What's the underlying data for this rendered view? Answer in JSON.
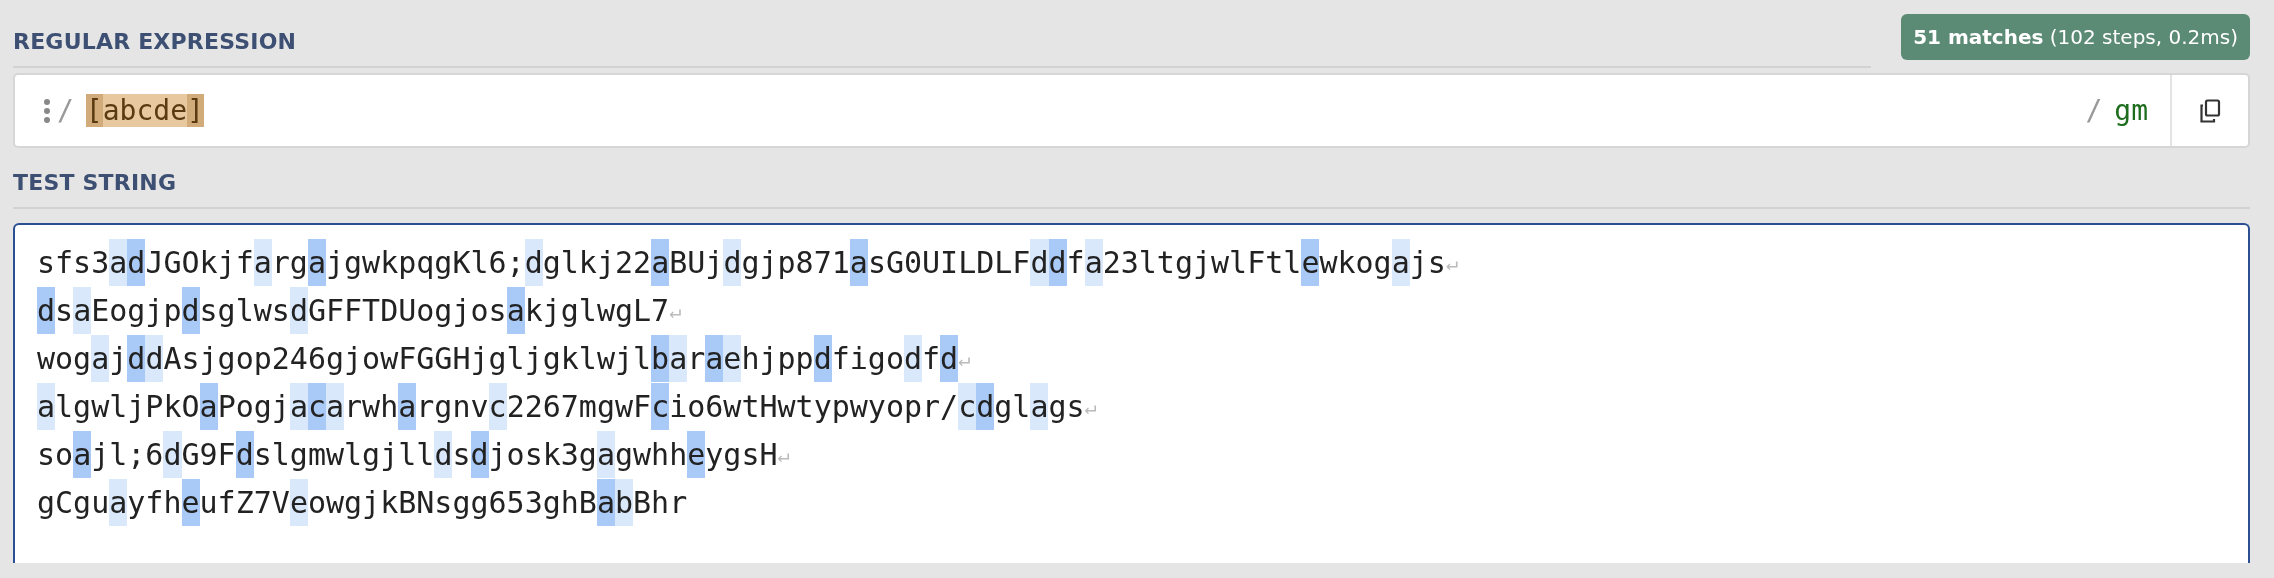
{
  "regex_section": {
    "title": "REGULAR EXPRESSION",
    "match_info": "**51 matches** (102 steps, 0.2ms)",
    "delimiter_open": "/",
    "pattern": [
      {
        "text": "[",
        "kind": "bracket"
      },
      {
        "text": "abcde",
        "kind": "set"
      },
      {
        "text": "]",
        "kind": "bracket"
      }
    ],
    "delimiter_close": "/",
    "flags": "gm"
  },
  "test_section": {
    "title": "TEST STRING",
    "lines": [
      {
        "end_mark": "↵",
        "segments": [
          {
            "text": "sfs3",
            "kind": "plain"
          },
          {
            "text": "a",
            "kind": "match"
          },
          {
            "text": "d",
            "kind": "match-alt"
          },
          {
            "text": "JGOkjf",
            "kind": "plain"
          },
          {
            "text": "a",
            "kind": "match"
          },
          {
            "text": "rg",
            "kind": "plain"
          },
          {
            "text": "a",
            "kind": "match-alt"
          },
          {
            "text": "jgwkpqgKl6;",
            "kind": "plain"
          },
          {
            "text": "d",
            "kind": "match"
          },
          {
            "text": "glkj22",
            "kind": "plain"
          },
          {
            "text": "a",
            "kind": "match-alt"
          },
          {
            "text": "BUj",
            "kind": "plain"
          },
          {
            "text": "d",
            "kind": "match"
          },
          {
            "text": "gjp871",
            "kind": "plain"
          },
          {
            "text": "a",
            "kind": "match-alt"
          },
          {
            "text": "sG0UILDLF",
            "kind": "plain"
          },
          {
            "text": "d",
            "kind": "match"
          },
          {
            "text": "d",
            "kind": "match-alt"
          },
          {
            "text": "f",
            "kind": "plain"
          },
          {
            "text": "a",
            "kind": "match"
          },
          {
            "text": "23ltgjwlFtl",
            "kind": "plain"
          },
          {
            "text": "e",
            "kind": "match-alt"
          },
          {
            "text": "wkog",
            "kind": "plain"
          },
          {
            "text": "a",
            "kind": "match"
          },
          {
            "text": "js",
            "kind": "plain"
          }
        ]
      },
      {
        "end_mark": "↵",
        "segments": [
          {
            "text": "d",
            "kind": "match-alt"
          },
          {
            "text": "s",
            "kind": "plain"
          },
          {
            "text": "a",
            "kind": "match"
          },
          {
            "text": "Eogjp",
            "kind": "plain"
          },
          {
            "text": "d",
            "kind": "match-alt"
          },
          {
            "text": "sglws",
            "kind": "plain"
          },
          {
            "text": "d",
            "kind": "match"
          },
          {
            "text": "GFFTDUogjos",
            "kind": "plain"
          },
          {
            "text": "a",
            "kind": "match-alt"
          },
          {
            "text": "kjglwgL7",
            "kind": "plain"
          }
        ]
      },
      {
        "end_mark": "↵",
        "segments": [
          {
            "text": "wog",
            "kind": "plain"
          },
          {
            "text": "a",
            "kind": "match"
          },
          {
            "text": "j",
            "kind": "plain"
          },
          {
            "text": "d",
            "kind": "match-alt"
          },
          {
            "text": "d",
            "kind": "match"
          },
          {
            "text": "Asjgop246gjowFGGHjgljgklwjl",
            "kind": "plain"
          },
          {
            "text": "b",
            "kind": "match-alt"
          },
          {
            "text": "a",
            "kind": "match"
          },
          {
            "text": "r",
            "kind": "plain"
          },
          {
            "text": "a",
            "kind": "match-alt"
          },
          {
            "text": "e",
            "kind": "match"
          },
          {
            "text": "hjpp",
            "kind": "plain"
          },
          {
            "text": "d",
            "kind": "match-alt"
          },
          {
            "text": "figo",
            "kind": "plain"
          },
          {
            "text": "d",
            "kind": "match"
          },
          {
            "text": "f",
            "kind": "plain"
          },
          {
            "text": "d",
            "kind": "match-alt"
          }
        ]
      },
      {
        "end_mark": "↵",
        "segments": [
          {
            "text": "a",
            "kind": "match"
          },
          {
            "text": "lgwljPkO",
            "kind": "plain"
          },
          {
            "text": "a",
            "kind": "match-alt"
          },
          {
            "text": "Pogj",
            "kind": "plain"
          },
          {
            "text": "a",
            "kind": "match"
          },
          {
            "text": "c",
            "kind": "match-alt"
          },
          {
            "text": "a",
            "kind": "match"
          },
          {
            "text": "rwh",
            "kind": "plain"
          },
          {
            "text": "a",
            "kind": "match-alt"
          },
          {
            "text": "rgnv",
            "kind": "plain"
          },
          {
            "text": "c",
            "kind": "match"
          },
          {
            "text": "2267mgwF",
            "kind": "plain"
          },
          {
            "text": "c",
            "kind": "match-alt"
          },
          {
            "text": "io6wtHwtypwyopr/",
            "kind": "plain"
          },
          {
            "text": "c",
            "kind": "match"
          },
          {
            "text": "d",
            "kind": "match-alt"
          },
          {
            "text": "gl",
            "kind": "plain"
          },
          {
            "text": "a",
            "kind": "match"
          },
          {
            "text": "gs",
            "kind": "plain"
          }
        ]
      },
      {
        "end_mark": "↵",
        "segments": [
          {
            "text": "so",
            "kind": "plain"
          },
          {
            "text": "a",
            "kind": "match-alt"
          },
          {
            "text": "jl;6",
            "kind": "plain"
          },
          {
            "text": "d",
            "kind": "match"
          },
          {
            "text": "G9F",
            "kind": "plain"
          },
          {
            "text": "d",
            "kind": "match-alt"
          },
          {
            "text": "slgmwlgjll",
            "kind": "plain"
          },
          {
            "text": "d",
            "kind": "match"
          },
          {
            "text": "s",
            "kind": "plain"
          },
          {
            "text": "d",
            "kind": "match-alt"
          },
          {
            "text": "josk3g",
            "kind": "plain"
          },
          {
            "text": "a",
            "kind": "match"
          },
          {
            "text": "gwhh",
            "kind": "plain"
          },
          {
            "text": "e",
            "kind": "match-alt"
          },
          {
            "text": "ygsH",
            "kind": "plain"
          }
        ]
      },
      {
        "segments": [
          {
            "text": "gCgu",
            "kind": "plain"
          },
          {
            "text": "a",
            "kind": "match"
          },
          {
            "text": "yfh",
            "kind": "plain"
          },
          {
            "text": "e",
            "kind": "match-alt"
          },
          {
            "text": "ufZ7V",
            "kind": "plain"
          },
          {
            "text": "e",
            "kind": "match"
          },
          {
            "text": "owgjkBNsgg653ghB",
            "kind": "plain"
          },
          {
            "text": "a",
            "kind": "match-alt"
          },
          {
            "text": "b",
            "kind": "match"
          },
          {
            "text": "Bhr",
            "kind": "plain"
          }
        ]
      }
    ]
  }
}
